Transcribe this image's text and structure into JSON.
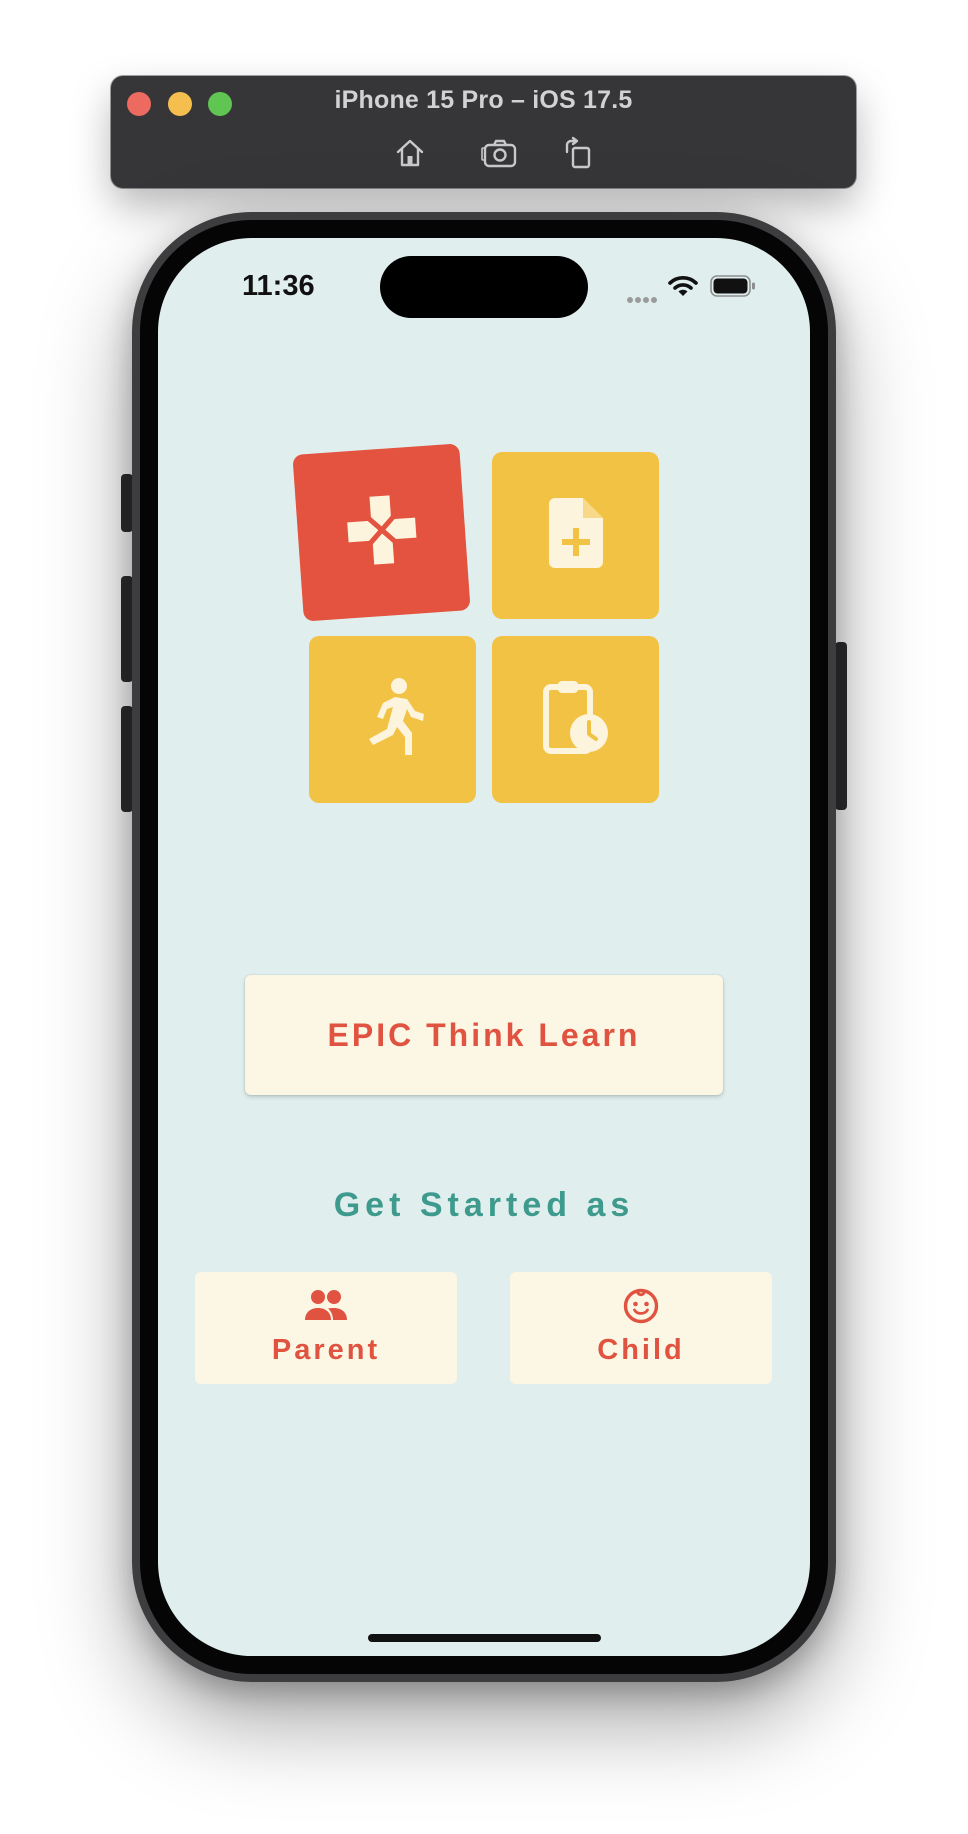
{
  "simulator": {
    "title": "iPhone 15 Pro – iOS 17.5",
    "tools": [
      "home-icon",
      "screenshot-icon",
      "rotate-icon"
    ]
  },
  "status_bar": {
    "time": "11:36",
    "icons": [
      "cellular-dots-icon",
      "wifi-icon",
      "battery-icon"
    ]
  },
  "logo_tiles": [
    {
      "icon": "gamepad-icon",
      "color": "#e35340"
    },
    {
      "icon": "note-add-icon",
      "color": "#f2c244"
    },
    {
      "icon": "running-figure-icon",
      "color": "#f2c244"
    },
    {
      "icon": "clipboard-clock-icon",
      "color": "#f2c244"
    }
  ],
  "app": {
    "title": "EPIC Think Learn",
    "get_started": "Get Started as",
    "roles": [
      {
        "label": "Parent",
        "icon": "people-icon"
      },
      {
        "label": "Child",
        "icon": "child-face-icon"
      }
    ]
  },
  "colors": {
    "background": "#e0efee",
    "accent_red": "#e05340",
    "accent_yellow": "#f2c244",
    "teal_text": "#3d9a8d",
    "card": "#fcf6e5"
  }
}
